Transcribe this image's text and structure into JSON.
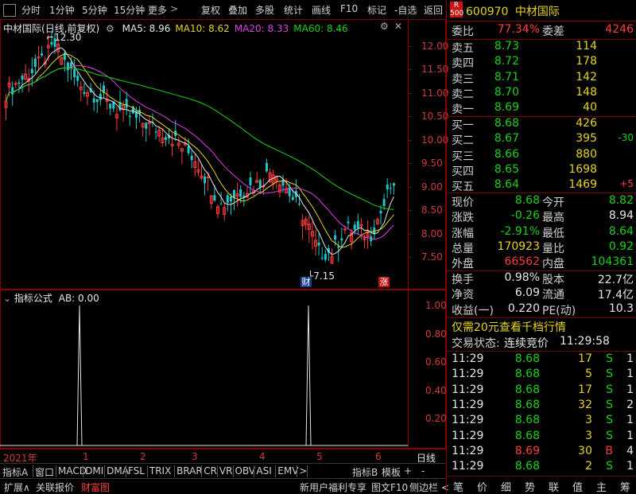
{
  "toolbar": {
    "left_items": [
      "分时",
      "1分钟",
      "5分钟",
      "15分钟",
      "更多"
    ],
    "right_items": [
      "复权",
      "叠加",
      "多股",
      "统计",
      "画线",
      "F10",
      "标记",
      "-自选",
      "返回"
    ]
  },
  "chart": {
    "stock_name": "中材国际",
    "mode": "(日线,前复权)",
    "ma": [
      {
        "label": "MA5: 8.96",
        "color": "#e6e6e6"
      },
      {
        "label": "MA10: 8.62",
        "color": "#e6d31e"
      },
      {
        "label": "MA20: 8.33",
        "color": "#e040e0"
      },
      {
        "label": "MA60: 8.46",
        "color": "#18d218"
      }
    ],
    "y_ticks": [
      "12.00",
      "11.50",
      "11.00",
      "10.50",
      "10.00",
      "9.50",
      "9.00",
      "8.50",
      "8.00",
      "7.50"
    ],
    "high_marker": "12.30",
    "low_marker": "7.15",
    "marker_cai": "财",
    "marker_zhang": "涨",
    "indicator_title": "指标公式",
    "indicator_value": "AB: 0.00",
    "ind_ticks": [
      "1.00",
      "0.80",
      "0.60",
      "0.40",
      "0.20"
    ],
    "x_labels": [
      "2021年",
      "1",
      "2",
      "3",
      "4",
      "5",
      "6"
    ],
    "period": "日线"
  },
  "tabs": {
    "row1": [
      "指标A",
      "窗口",
      "MACD",
      "DMI",
      "DMA",
      "FSL",
      "TRIX",
      "BRAR",
      "CR",
      "VR",
      "OBV",
      "ASI",
      "EMV",
      ">"
    ],
    "row1_right": [
      "指标B",
      "模板",
      "+",
      "-"
    ],
    "row2_left": [
      "扩展∧",
      "关联报价",
      "财富图"
    ],
    "row2_right": [
      "新用户福利专享",
      "图文F10",
      "侧边栏 <"
    ],
    "side_tabs": [
      "笔",
      "价",
      "细",
      "势",
      "联",
      "值",
      "主",
      "筹"
    ]
  },
  "quote": {
    "r_badge": "R",
    "r_sub": "500",
    "code": "600970",
    "name": "中材国际",
    "weibi_label": "委比",
    "weibi": "77.34%",
    "weicha_label": "委差",
    "weicha": "4246",
    "sells": [
      {
        "label": "卖五",
        "price": "8.73",
        "vol": "114",
        "chg": ""
      },
      {
        "label": "卖四",
        "price": "8.72",
        "vol": "178",
        "chg": ""
      },
      {
        "label": "卖三",
        "price": "8.71",
        "vol": "142",
        "chg": ""
      },
      {
        "label": "卖二",
        "price": "8.70",
        "vol": "148",
        "chg": ""
      },
      {
        "label": "卖一",
        "price": "8.69",
        "vol": "40",
        "chg": ""
      }
    ],
    "buys": [
      {
        "label": "买一",
        "price": "8.68",
        "vol": "426",
        "chg": ""
      },
      {
        "label": "买二",
        "price": "8.67",
        "vol": "395",
        "chg": "-30"
      },
      {
        "label": "买三",
        "price": "8.66",
        "vol": "880",
        "chg": ""
      },
      {
        "label": "买四",
        "price": "8.65",
        "vol": "1698",
        "chg": ""
      },
      {
        "label": "买五",
        "price": "8.64",
        "vol": "1469",
        "chg": "+5"
      }
    ],
    "stats": [
      {
        "l1": "现价",
        "v1": "8.68",
        "c1": "grn",
        "l2": "今开",
        "v2": "8.82",
        "c2": "grn"
      },
      {
        "l1": "涨跌",
        "v1": "-0.26",
        "c1": "grn",
        "l2": "最高",
        "v2": "8.94",
        "c2": "wht"
      },
      {
        "l1": "涨幅",
        "v1": "-2.91%",
        "c1": "grn",
        "l2": "最低",
        "v2": "8.64",
        "c2": "grn"
      },
      {
        "l1": "总量",
        "v1": "170923",
        "c1": "yel",
        "l2": "量比",
        "v2": "0.92",
        "c2": "grn"
      },
      {
        "l1": "外盘",
        "v1": "66562",
        "c1": "red",
        "l2": "内盘",
        "v2": "104361",
        "c2": "grn"
      }
    ],
    "stats2": [
      {
        "l1": "换手",
        "v1": "0.98%",
        "l2": "股本",
        "v2": "22.7亿"
      },
      {
        "l1": "净资",
        "v1": "6.09",
        "l2": "流通",
        "v2": "17.4亿"
      },
      {
        "l1": "收益(一)",
        "v1": "0.220",
        "l2": "PE(动)",
        "v2": "10.3"
      }
    ],
    "promo": "仅需20元查看千档行情",
    "status_label": "交易状态:",
    "status_value": "连续竞价",
    "status_time": "11:29:58",
    "ticks": [
      {
        "time": "11:29",
        "price": "8.68",
        "vol": "17",
        "side": "S",
        "n": "1"
      },
      {
        "time": "11:29",
        "price": "8.68",
        "vol": "5",
        "side": "S",
        "n": "1"
      },
      {
        "time": "11:29",
        "price": "8.68",
        "vol": "17",
        "side": "S",
        "n": "1"
      },
      {
        "time": "11:29",
        "price": "8.68",
        "vol": "32",
        "side": "S",
        "n": "2"
      },
      {
        "time": "11:29",
        "price": "8.68",
        "vol": "3",
        "side": "S",
        "n": "1"
      },
      {
        "time": "11:29",
        "price": "8.68",
        "vol": "3",
        "side": "S",
        "n": "1"
      },
      {
        "time": "11:29",
        "price": "8.69",
        "vol": "30",
        "side": "B",
        "n": "4"
      },
      {
        "time": "11:29",
        "price": "8.68",
        "vol": "2",
        "side": "S",
        "n": "1"
      }
    ]
  },
  "colors": {
    "up": "#ff3c3c",
    "down": "#18d218",
    "price": "#e6d31e",
    "frame": "#8a0000",
    "axis": "#d23a3a"
  }
}
